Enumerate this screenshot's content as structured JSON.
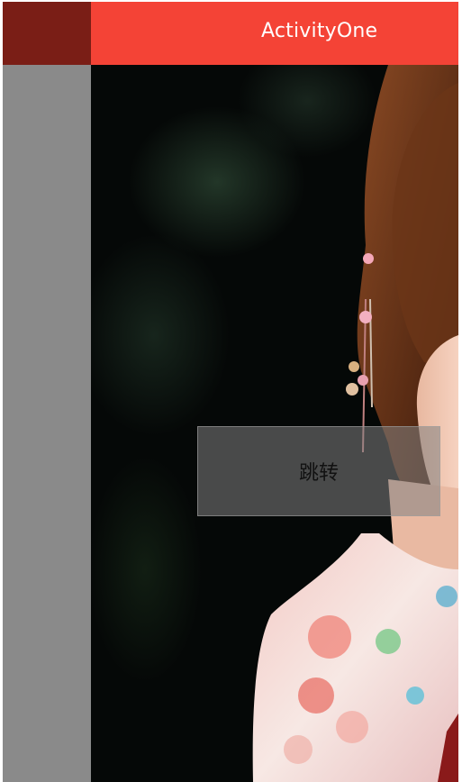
{
  "app": {
    "title": "ActivityOne"
  },
  "main": {
    "button_label": "跳转"
  },
  "colors": {
    "action_bar": "#f44336",
    "status_dark": "#7a1e16",
    "side_panel": "#8a8a8a"
  },
  "background": {
    "image": "woman-portrait-photo"
  }
}
